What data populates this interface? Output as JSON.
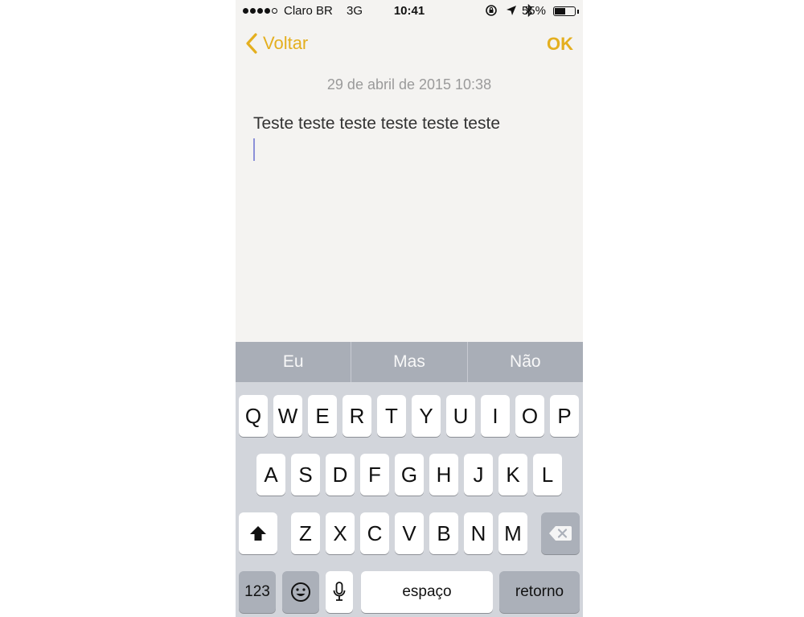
{
  "status_bar": {
    "carrier": "Claro BR",
    "network": "3G",
    "time": "10:41",
    "battery_percent": "55%",
    "battery_level": 0.55,
    "icons": [
      "rotation-lock-icon",
      "location-arrow-icon",
      "bluetooth-icon"
    ]
  },
  "nav": {
    "back_label": "Voltar",
    "done_label": "OK"
  },
  "note": {
    "date": "29 de abril de 2015 10:38",
    "body": "Teste teste teste teste teste teste"
  },
  "predictive": [
    "Eu",
    "Mas",
    "Não"
  ],
  "keyboard": {
    "row1": [
      "Q",
      "W",
      "E",
      "R",
      "T",
      "Y",
      "U",
      "I",
      "O",
      "P"
    ],
    "row2": [
      "A",
      "S",
      "D",
      "F",
      "G",
      "H",
      "J",
      "K",
      "L"
    ],
    "row3": [
      "Z",
      "X",
      "C",
      "V",
      "B",
      "N",
      "M"
    ],
    "numbers_label": "123",
    "space_label": "espaço",
    "return_label": "retorno"
  },
  "colors": {
    "accent": "#e4af1f",
    "paper": "#f4f3f1",
    "keyboard_bg": "#d2d5db",
    "predictive_bg": "#a9aeb7"
  }
}
